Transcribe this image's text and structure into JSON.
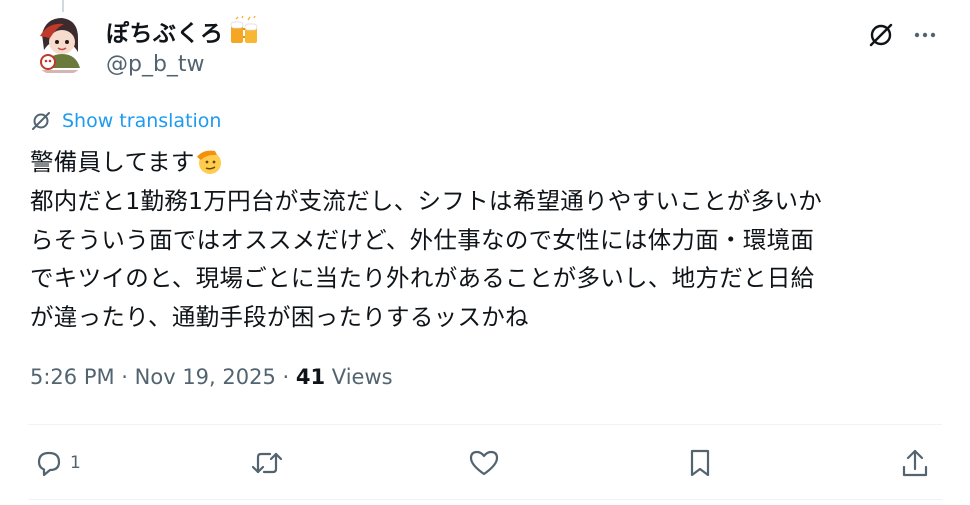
{
  "author": {
    "display_name": "ぽちぶくろ",
    "handle": "@p_b_tw",
    "avatar_caption": "Pochi Bukuro"
  },
  "header_icons": [
    "grok-icon",
    "more-icon"
  ],
  "translation": {
    "label": "Show translation",
    "icon": "translate-icon"
  },
  "body": {
    "line1": "警備員してます",
    "line2": "都内だと1勤務1万円台が支流だし、シフトは希望通りやすいことが多いか",
    "line3": "らそういう面ではオススメだけど、外仕事なので女性には体力面・環境面",
    "line4": "でキツイのと、現場ごとに当たり外れがあることが多いし、地方だと日給",
    "line5": "が違ったり、通勤手段が困ったりするッスかね"
  },
  "meta": {
    "time": "5:26 PM",
    "sep1": " · ",
    "date": "Nov 19, 2025",
    "sep2": " · ",
    "views_count": "41",
    "views_label": " Views"
  },
  "actions": {
    "reply_count": "1",
    "icons": [
      "reply-icon",
      "retweet-icon",
      "like-icon",
      "bookmark-icon",
      "share-icon"
    ]
  },
  "colors": {
    "text": "#0f1419",
    "secondary": "#536471",
    "link": "#1d9bf0",
    "divider": "#eff3f4"
  }
}
